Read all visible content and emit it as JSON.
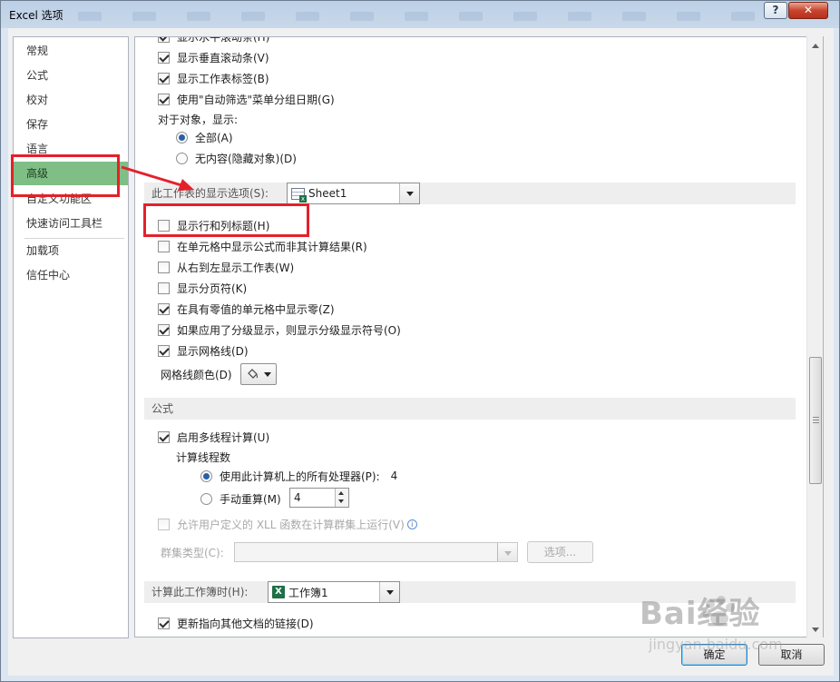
{
  "window": {
    "title": "Excel 选项"
  },
  "titlebar": {
    "help_label": "?",
    "close_label": "✕"
  },
  "nav": {
    "items": [
      {
        "label": "常规"
      },
      {
        "label": "公式"
      },
      {
        "label": "校对"
      },
      {
        "label": "保存"
      },
      {
        "label": "语言"
      },
      {
        "label": "高级",
        "selected": true
      },
      {
        "label": "自定义功能区"
      },
      {
        "label": "快速访问工具栏"
      },
      {
        "label": "加载项"
      },
      {
        "label": "信任中心"
      }
    ]
  },
  "workbook_options": {
    "partial_top": "显示水平滚动条(H)",
    "vertical_scrollbar": {
      "label": "显示垂直滚动条(V)",
      "checked": true
    },
    "sheet_tabs": {
      "label": "显示工作表标签(B)",
      "checked": true
    },
    "group_dates": {
      "label": "使用\"自动筛选\"菜单分组日期(G)",
      "checked": true
    },
    "objects_label": "对于对象，显示:",
    "show_all": {
      "label": "全部(A)",
      "checked": true
    },
    "show_none": {
      "label": "无内容(隐藏对象)(D)",
      "checked": false
    }
  },
  "sheet_options": {
    "header": "此工作表的显示选项(S):",
    "sheet_select": "Sheet1",
    "row_col_headers": {
      "label": "显示行和列标题(H)",
      "checked": false
    },
    "show_formulas": {
      "label": "在单元格中显示公式而非其计算结果(R)",
      "checked": false
    },
    "right_to_left": {
      "label": "从右到左显示工作表(W)",
      "checked": false
    },
    "page_breaks": {
      "label": "显示分页符(K)",
      "checked": false
    },
    "zero_values": {
      "label": "在具有零值的单元格中显示零(Z)",
      "checked": true
    },
    "outline_symbols": {
      "label": "如果应用了分级显示，则显示分级显示符号(O)",
      "checked": true
    },
    "gridlines": {
      "label": "显示网格线(D)",
      "checked": true
    },
    "gridline_color_label": "网格线颜色(D)"
  },
  "formulas": {
    "header": "公式",
    "multithread": {
      "label": "启用多线程计算(U)",
      "checked": true
    },
    "threads_label": "计算线程数",
    "all_processors": {
      "label": "使用此计算机上的所有处理器(P):",
      "value": "4",
      "checked": true
    },
    "manual": {
      "label": "手动重算(M)",
      "value": "4",
      "checked": false
    },
    "xll": {
      "label": "允许用户定义的 XLL 函数在计算群集上运行(V)",
      "checked": false
    },
    "cluster_type_label": "群集类型(C):",
    "options_button": "选项..."
  },
  "calc_workbook": {
    "header": "计算此工作簿时(H):",
    "workbook_select": "工作簿1",
    "update_links": {
      "label": "更新指向其他文档的链接(D)",
      "checked": true
    }
  },
  "footer": {
    "ok_label": "确定",
    "cancel_label": "取消"
  },
  "watermark": {
    "brand": "Bai经验",
    "url": "jingyan.baidu.com"
  },
  "colors": {
    "highlight": "#e5202a",
    "nav_selected": "#7fbf85"
  }
}
